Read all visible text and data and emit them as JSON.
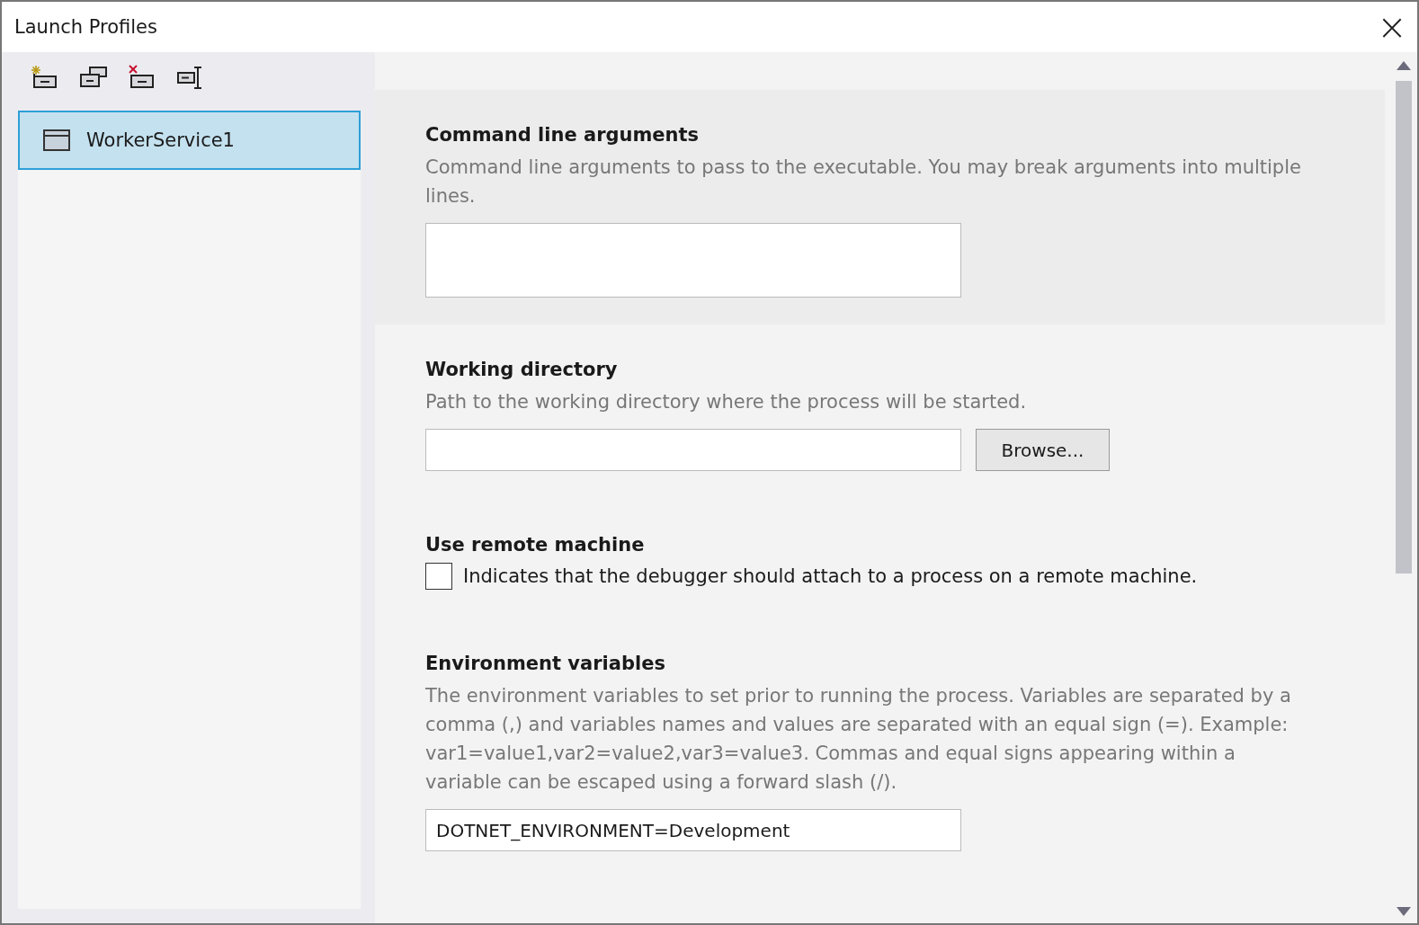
{
  "window": {
    "title": "Launch Profiles",
    "close": "×"
  },
  "profiles": [
    {
      "label": "WorkerService1",
      "selected": true
    }
  ],
  "sections": [
    {
      "kind": "multiline",
      "title": "Command line arguments",
      "description": "Command line arguments to pass to the executable. You may break arguments into multiple lines.",
      "highlighted": true
    },
    {
      "kind": "path",
      "title": "Working directory",
      "description": "Path to the working directory where the process will be started.",
      "button": "Browse...",
      "highlighted": false
    },
    {
      "kind": "checkbox",
      "title": "Use remote machine",
      "label": "Indicates that the debugger should attach to a process on a remote machine.",
      "checked": false,
      "highlighted": false
    },
    {
      "kind": "text",
      "title": "Environment variables",
      "description": "The environment variables to set prior to running the process. Variables are separated by a comma (,) and variables names and values are separated with an equal sign (=). Example: var1=value1,var2=value2,var3=value3. Commas and equal signs appearing within a variable can be escaped using a forward slash (/).",
      "value": "DOTNET_ENVIRONMENT=Development",
      "highlighted": false
    }
  ]
}
